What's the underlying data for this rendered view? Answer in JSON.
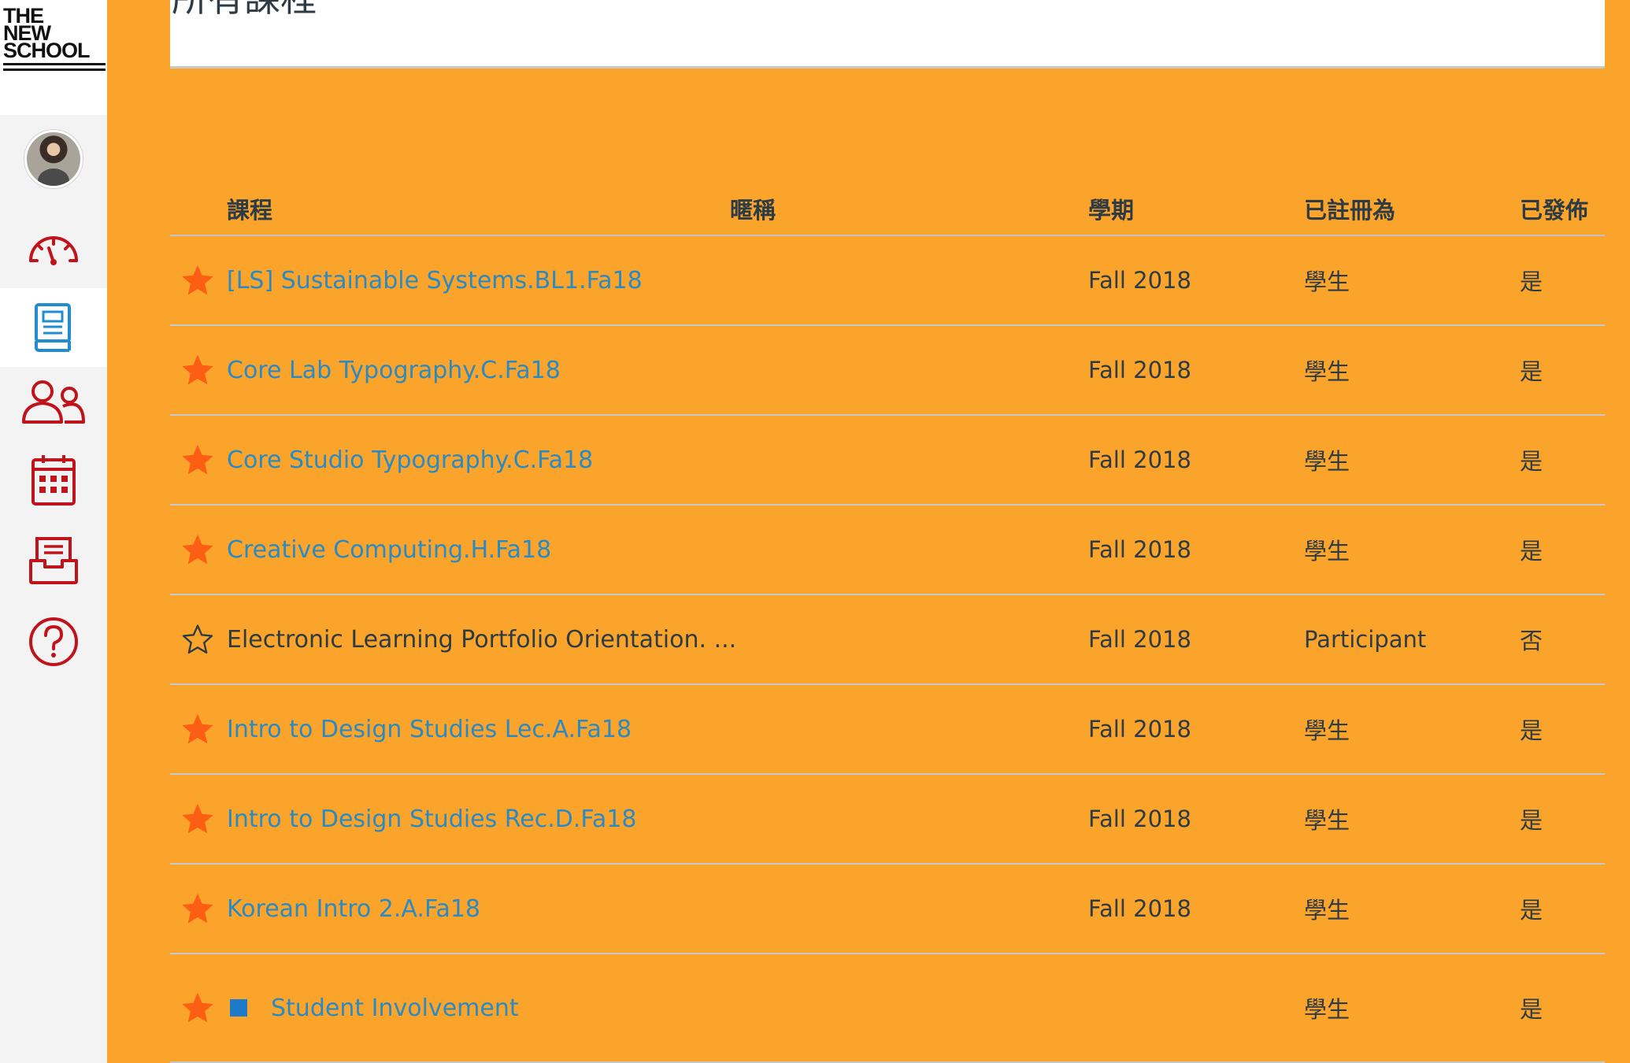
{
  "logo": {
    "lines": [
      "THE",
      "NEW",
      "SCHOOL"
    ]
  },
  "nav": {
    "items": [
      {
        "name": "account",
        "icon": "avatar"
      },
      {
        "name": "dashboard",
        "icon": "speedometer-icon"
      },
      {
        "name": "courses",
        "icon": "book-icon",
        "active": true
      },
      {
        "name": "groups",
        "icon": "people-icon"
      },
      {
        "name": "calendar",
        "icon": "calendar-icon"
      },
      {
        "name": "inbox",
        "icon": "inbox-icon"
      },
      {
        "name": "help",
        "icon": "question-icon"
      }
    ],
    "icon_color": "#c0141c",
    "active_icon_color": "#1f8dd0"
  },
  "page": {
    "title": "所有課程"
  },
  "table": {
    "headers": {
      "course": "課程",
      "nickname": "暱稱",
      "term": "學期",
      "enrolled_as": "已註冊為",
      "published": "已發佈"
    },
    "rows": [
      {
        "favorite": true,
        "name": "[LS] Sustainable Systems.BL1.Fa18",
        "link": true,
        "term": "Fall 2018",
        "enrolled_as": "學生",
        "published": "是"
      },
      {
        "favorite": true,
        "name": "Core Lab Typography.C.Fa18",
        "link": true,
        "term": "Fall 2018",
        "enrolled_as": "學生",
        "published": "是"
      },
      {
        "favorite": true,
        "name": "Core Studio Typography.C.Fa18",
        "link": true,
        "term": "Fall 2018",
        "enrolled_as": "學生",
        "published": "是"
      },
      {
        "favorite": true,
        "name": "Creative Computing.H.Fa18",
        "link": true,
        "term": "Fall 2018",
        "enrolled_as": "學生",
        "published": "是"
      },
      {
        "favorite": false,
        "name": "Electronic Learning Portfolio Orientation. ...",
        "link": false,
        "term": "Fall 2018",
        "enrolled_as": "Participant",
        "published": "否"
      },
      {
        "favorite": true,
        "name": "Intro to Design Studies Lec.A.Fa18",
        "link": true,
        "term": "Fall 2018",
        "enrolled_as": "學生",
        "published": "是"
      },
      {
        "favorite": true,
        "name": "Intro to Design Studies Rec.D.Fa18",
        "link": true,
        "term": "Fall 2018",
        "enrolled_as": "學生",
        "published": "是"
      },
      {
        "favorite": true,
        "name": "Korean Intro 2.A.Fa18",
        "link": true,
        "term": "Fall 2018",
        "enrolled_as": "學生",
        "published": "是"
      },
      {
        "favorite": true,
        "name": "Student Involvement",
        "link": true,
        "term": "",
        "enrolled_as": "學生",
        "published": "是",
        "swatch_color": "#1d7ac9"
      }
    ]
  },
  "colors": {
    "background": "#fba42b",
    "link": "#2b8ac2",
    "text": "#2d3b45",
    "star_filled": "#fc5e13"
  }
}
